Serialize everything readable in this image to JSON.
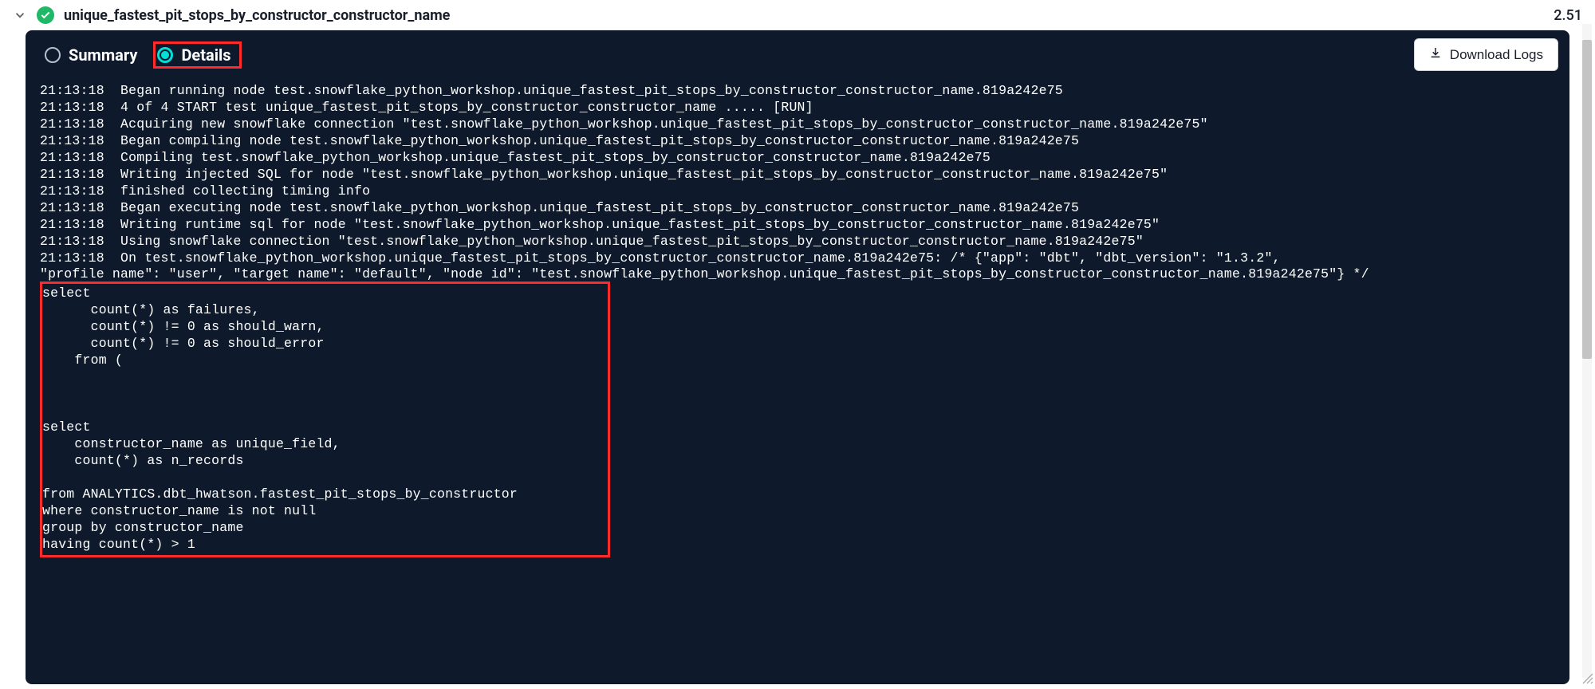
{
  "header": {
    "title": "unique_fastest_pit_stops_by_constructor_constructor_name",
    "elapsed": "2.51"
  },
  "tabs": {
    "summary_label": "Summary",
    "details_label": "Details"
  },
  "actions": {
    "download_label": "Download Logs"
  },
  "logs": {
    "preamble": "21:13:18  Began running node test.snowflake_python_workshop.unique_fastest_pit_stops_by_constructor_constructor_name.819a242e75\n21:13:18  4 of 4 START test unique_fastest_pit_stops_by_constructor_constructor_name ..... [RUN]\n21:13:18  Acquiring new snowflake connection \"test.snowflake_python_workshop.unique_fastest_pit_stops_by_constructor_constructor_name.819a242e75\"\n21:13:18  Began compiling node test.snowflake_python_workshop.unique_fastest_pit_stops_by_constructor_constructor_name.819a242e75\n21:13:18  Compiling test.snowflake_python_workshop.unique_fastest_pit_stops_by_constructor_constructor_name.819a242e75\n21:13:18  Writing injected SQL for node \"test.snowflake_python_workshop.unique_fastest_pit_stops_by_constructor_constructor_name.819a242e75\"\n21:13:18  finished collecting timing info\n21:13:18  Began executing node test.snowflake_python_workshop.unique_fastest_pit_stops_by_constructor_constructor_name.819a242e75\n21:13:18  Writing runtime sql for node \"test.snowflake_python_workshop.unique_fastest_pit_stops_by_constructor_constructor_name.819a242e75\"\n21:13:18  Using snowflake connection \"test.snowflake_python_workshop.unique_fastest_pit_stops_by_constructor_constructor_name.819a242e75\"\n21:13:18  On test.snowflake_python_workshop.unique_fastest_pit_stops_by_constructor_constructor_name.819a242e75: /* {\"app\": \"dbt\", \"dbt_version\": \"1.3.2\",\n\"profile name\": \"user\", \"target name\": \"default\", \"node id\": \"test.snowflake_python_workshop.unique_fastest_pit_stops_by_constructor_constructor_name.819a242e75\"} */",
    "sql_block": "select\n      count(*) as failures,\n      count(*) != 0 as should_warn,\n      count(*) != 0 as should_error\n    from (\n      \n    \n    \nselect\n    constructor_name as unique_field,\n    count(*) as n_records\n\nfrom ANALYTICS.dbt_hwatson.fastest_pit_stops_by_constructor\nwhere constructor_name is not null\ngroup by constructor_name\nhaving count(*) > 1"
  }
}
